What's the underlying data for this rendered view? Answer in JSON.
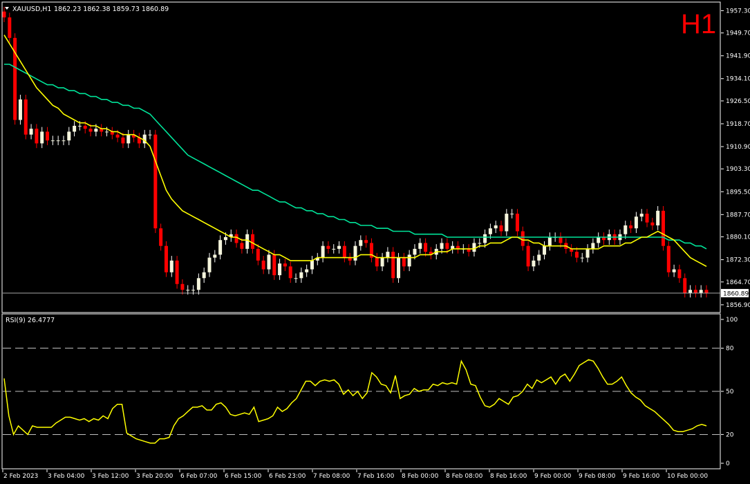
{
  "header": {
    "symbol": "XAUUSD,H1",
    "ohlc": "1862.23 1862.38 1859.73 1860.89",
    "timeframe_badge": "H1"
  },
  "indicator": {
    "label": "RSI(9) 26.4777",
    "levels": [
      80,
      50,
      20
    ],
    "axis_ticks": [
      "100",
      "80",
      "50",
      "20",
      "0"
    ]
  },
  "price_axis": {
    "ticks": [
      "1957.30",
      "1949.70",
      "1941.90",
      "1934.10",
      "1926.50",
      "1918.70",
      "1910.90",
      "1903.30",
      "1895.50",
      "1887.70",
      "1880.10",
      "1872.30",
      "1864.70",
      "1856.90"
    ],
    "current": "1860.89"
  },
  "time_axis": {
    "labels": [
      "2 Feb 2023",
      "3 Feb 04:00",
      "3 Feb 12:00",
      "3 Feb 20:00",
      "6 Feb 07:00",
      "6 Feb 15:00",
      "6 Feb 23:00",
      "7 Feb 08:00",
      "7 Feb 16:00",
      "8 Feb 00:00",
      "8 Feb 08:00",
      "8 Feb 16:00",
      "9 Feb 00:00",
      "9 Feb 08:00",
      "9 Feb 16:00",
      "10 Feb 00:00"
    ]
  },
  "colors": {
    "background": "#000000",
    "bull": "#f5f5dc",
    "bear": "#ff0000",
    "ma_fast": "#ffff00",
    "ma_slow": "#00e59a",
    "rsi": "#ffff00",
    "axis": "#ffffff"
  },
  "chart_data": [
    {
      "type": "candlestick",
      "ylim": [
        1854.5,
        1960.0
      ],
      "series": [
        {
          "name": "candles",
          "close": [
            1955,
            1948,
            1920,
            1927,
            1915,
            1917,
            1912,
            1916,
            1913,
            1913,
            1913,
            1913,
            1916,
            1918,
            1918,
            1917,
            1916,
            1917,
            1916,
            1916,
            1915,
            1914,
            1912,
            1915,
            1914,
            1912,
            1915,
            1915,
            1883,
            1877,
            1868,
            1872,
            1864,
            1862,
            1862,
            1862,
            1866,
            1868,
            1873,
            1874,
            1879,
            1880,
            1881,
            1878,
            1876,
            1881,
            1876,
            1872,
            1869,
            1874,
            1867,
            1871,
            1870,
            1866,
            1866,
            1868,
            1869,
            1872,
            1873,
            1877,
            1876,
            1876,
            1877,
            1873,
            1872,
            1877,
            1879,
            1878,
            1873,
            1870,
            1873,
            1875,
            1866,
            1873,
            1870,
            1874,
            1876,
            1878,
            1875,
            1874,
            1876,
            1878,
            1876,
            1877,
            1876,
            1876,
            1875,
            1878,
            1878,
            1881,
            1883,
            1884,
            1882,
            1888,
            1888,
            1882,
            1877,
            1870,
            1872,
            1874,
            1877,
            1880,
            1880,
            1878,
            1876,
            1875,
            1873,
            1873,
            1876,
            1878,
            1880,
            1879,
            1881,
            1879,
            1881,
            1884,
            1883,
            1887,
            1888,
            1885,
            1884,
            1889,
            1877,
            1868,
            1869,
            1866,
            1861,
            1862,
            1861,
            1862,
            1861
          ]
        },
        {
          "name": "ma_fast",
          "values": [
            1949,
            1946,
            1943,
            1940,
            1937,
            1934,
            1931,
            1929,
            1927,
            1925,
            1924,
            1922,
            1921,
            1920,
            1919,
            1919,
            1918,
            1918,
            1917,
            1917,
            1916,
            1916,
            1915,
            1915,
            1915,
            1914,
            1913,
            1911,
            1906,
            1901,
            1896,
            1893,
            1891,
            1889,
            1888,
            1887,
            1886,
            1885,
            1884,
            1883,
            1882,
            1881,
            1880,
            1880,
            1879,
            1879,
            1878,
            1877,
            1876,
            1875,
            1874,
            1874,
            1873,
            1872,
            1872,
            1872,
            1872,
            1872,
            1873,
            1873,
            1873,
            1873,
            1873,
            1873,
            1873,
            1873,
            1874,
            1874,
            1874,
            1873,
            1873,
            1873,
            1873,
            1873,
            1873,
            1873,
            1873,
            1874,
            1874,
            1874,
            1875,
            1875,
            1875,
            1876,
            1876,
            1876,
            1876,
            1876,
            1877,
            1877,
            1878,
            1878,
            1878,
            1879,
            1880,
            1880,
            1879,
            1879,
            1878,
            1878,
            1877,
            1877,
            1877,
            1877,
            1877,
            1876,
            1876,
            1876,
            1876,
            1876,
            1876,
            1877,
            1877,
            1877,
            1877,
            1878,
            1878,
            1879,
            1880,
            1880,
            1881,
            1882,
            1881,
            1880,
            1879,
            1877,
            1875,
            1873,
            1872,
            1871,
            1870
          ]
        },
        {
          "name": "ma_slow",
          "values": [
            1939,
            1939,
            1938,
            1937,
            1936,
            1935,
            1934,
            1933,
            1932,
            1932,
            1931,
            1931,
            1930,
            1930,
            1929,
            1929,
            1928,
            1928,
            1927,
            1927,
            1926,
            1926,
            1925,
            1925,
            1924,
            1924,
            1923,
            1922,
            1920,
            1918,
            1916,
            1914,
            1912,
            1910,
            1908,
            1907,
            1906,
            1905,
            1904,
            1903,
            1902,
            1901,
            1900,
            1899,
            1898,
            1897,
            1896,
            1896,
            1895,
            1894,
            1893,
            1892,
            1892,
            1891,
            1890,
            1890,
            1889,
            1889,
            1888,
            1888,
            1887,
            1887,
            1886,
            1886,
            1885,
            1885,
            1884,
            1884,
            1884,
            1883,
            1883,
            1883,
            1882,
            1882,
            1882,
            1882,
            1881,
            1881,
            1881,
            1881,
            1881,
            1881,
            1880,
            1880,
            1880,
            1880,
            1880,
            1880,
            1880,
            1880,
            1880,
            1880,
            1880,
            1880,
            1880,
            1880,
            1880,
            1880,
            1880,
            1880,
            1880,
            1880,
            1880,
            1880,
            1880,
            1880,
            1880,
            1880,
            1880,
            1880,
            1880,
            1880,
            1880,
            1880,
            1880,
            1880,
            1880,
            1880,
            1880,
            1880,
            1880,
            1880,
            1880,
            1879,
            1879,
            1879,
            1878,
            1878,
            1877,
            1877,
            1876
          ]
        }
      ],
      "current_price": 1860.89
    },
    {
      "type": "line",
      "ylim": [
        0,
        100
      ],
      "series": [
        {
          "name": "RSI(9)",
          "values": [
            59,
            33,
            20,
            26,
            23,
            20,
            26,
            25,
            25,
            25,
            25,
            28,
            30,
            32,
            32,
            31,
            30,
            31,
            29,
            31,
            30,
            33,
            31,
            38,
            41,
            41,
            21,
            19,
            17,
            16,
            15,
            14,
            14,
            17,
            17,
            18,
            26,
            31,
            33,
            36,
            39,
            39,
            40,
            37,
            37,
            41,
            42,
            39,
            34,
            33,
            34,
            35,
            34,
            39,
            29,
            30,
            31,
            33,
            39,
            36,
            38,
            42,
            45,
            51,
            57,
            57,
            54,
            57,
            58,
            57,
            58,
            55,
            48,
            51,
            47,
            50,
            45,
            49,
            63,
            60,
            55,
            54,
            49,
            61,
            45,
            47,
            48,
            52,
            50,
            51,
            51,
            55,
            54,
            56,
            55,
            56,
            55,
            71,
            65,
            55,
            54,
            46,
            40,
            39,
            41,
            45,
            43,
            41,
            46,
            47,
            50,
            55,
            52,
            58,
            56,
            58,
            60,
            55,
            60,
            62,
            57,
            62,
            68,
            70,
            72,
            71,
            66,
            60,
            55,
            55,
            57,
            60,
            54,
            49,
            46,
            44,
            40,
            38,
            36,
            33,
            30,
            27,
            23,
            22,
            22,
            23,
            24,
            26,
            27,
            26
          ]
        }
      ]
    }
  ]
}
